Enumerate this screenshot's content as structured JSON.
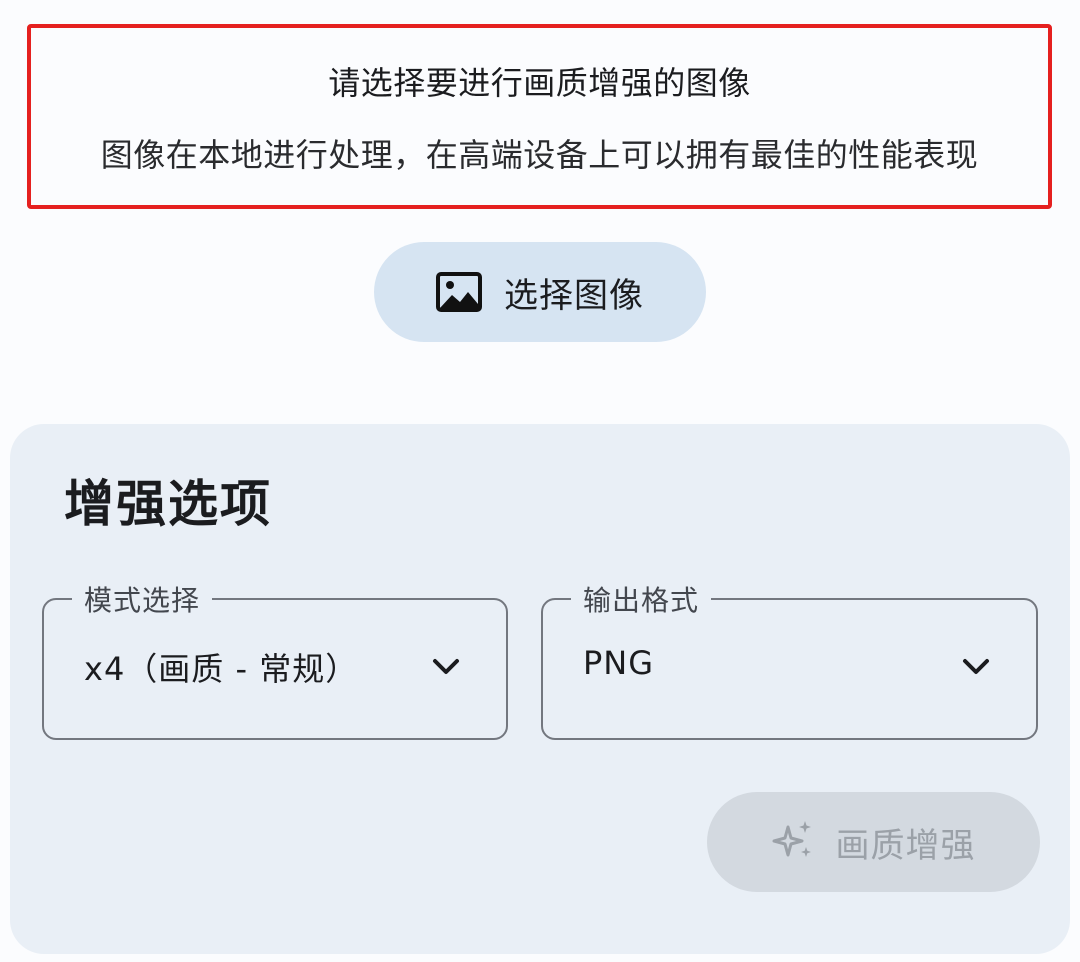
{
  "info": {
    "title": "请选择要进行画质增强的图像",
    "subtitle": "图像在本地进行处理，在高端设备上可以拥有最佳的性能表现"
  },
  "pick_button": {
    "label": "选择图像",
    "icon": "image-icon"
  },
  "options": {
    "title": "增强选项",
    "mode": {
      "legend": "模式选择",
      "value": "x4（画质 - 常规）",
      "icon": "chevron-down-icon"
    },
    "format": {
      "legend": "输出格式",
      "value": "PNG",
      "icon": "chevron-down-icon"
    },
    "enhance_button": {
      "label": "画质增强",
      "icon": "sparkle-icon",
      "enabled": false
    }
  },
  "colors": {
    "highlight_border": "#e5201f",
    "pick_button_bg": "#d6e4f2",
    "card_bg": "#e9eff6",
    "disabled_button_bg": "#d3d9e0"
  }
}
